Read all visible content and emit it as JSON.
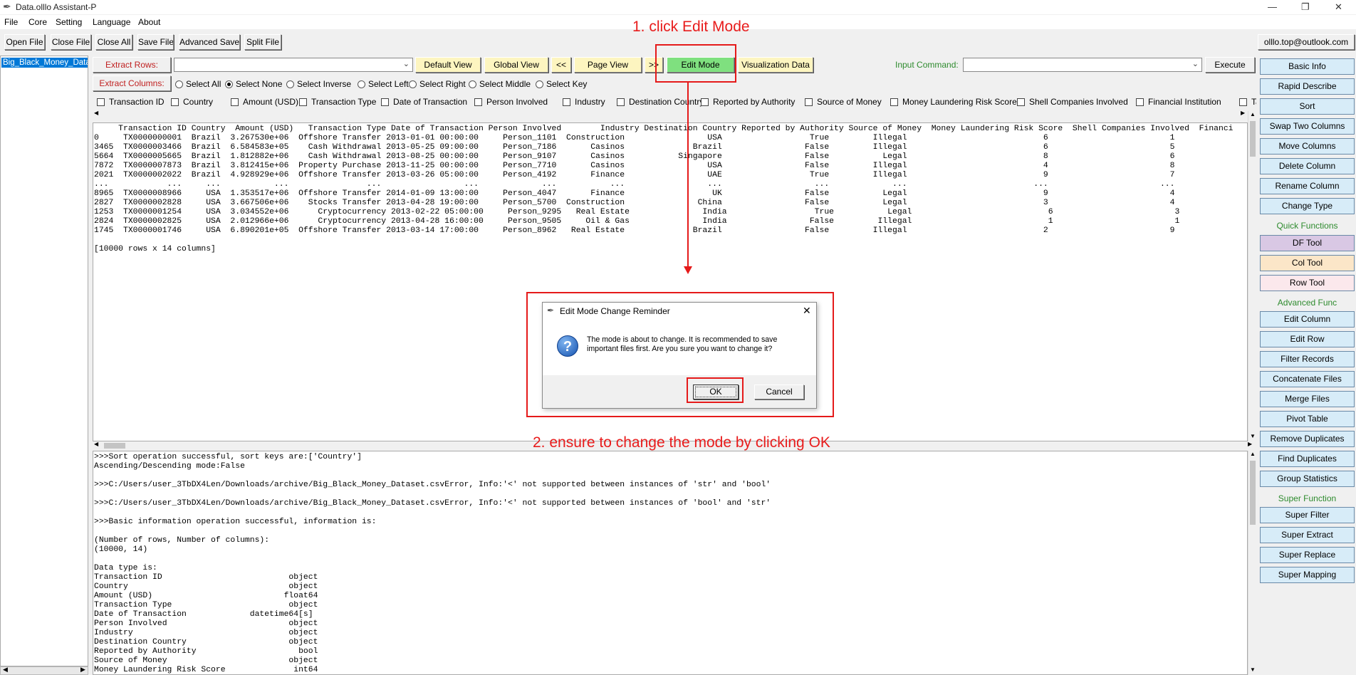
{
  "window": {
    "title": "Data.olllo Assistant-P",
    "minimize_glyph": "—",
    "restore_glyph": "❐",
    "close_glyph": "✕"
  },
  "menu": [
    "File",
    "Core",
    "Setting",
    "Language",
    "About"
  ],
  "toolbar": {
    "open_file": "Open File",
    "close_file": "Close File",
    "close_all": "Close All",
    "save_file": "Save File",
    "advanced_save": "Advanced Save",
    "split_file": "Split File"
  },
  "account": "olllo.top@outlook.com",
  "file_list": {
    "selected": "Big_Black_Money_Data"
  },
  "view_bar": {
    "extract_rows": "Extract Rows:",
    "extract_rows_value": "",
    "default_view": "Default View",
    "global_view": "Global View",
    "prev": "<<",
    "page_view": "Page View",
    "next": ">>",
    "edit_mode": "Edit Mode",
    "visualization": "Visualization Data",
    "input_command_label": "Input Command:",
    "input_command_value": "",
    "execute": "Execute"
  },
  "extract_columns": {
    "label": "Extract Columns:",
    "options": [
      "Select All",
      "Select None",
      "Select Inverse",
      "Select Left",
      "Select Right",
      "Select Middle",
      "Select Key"
    ],
    "selected": "Select None"
  },
  "columns_checklist": [
    "Transaction ID",
    "Country",
    "Amount (USD)",
    "Transaction Type",
    "Date of Transaction",
    "Person Involved",
    "Industry",
    "Destination Country",
    "Reported by Authority",
    "Source of Money",
    "Money Laundering Risk Score",
    "Shell Companies Involved",
    "Financial Institution",
    "Tax H"
  ],
  "table_output": [
    "     Transaction ID Country  Amount (USD)   Transaction Type Date of Transaction Person Involved        Industry Destination Country Reported by Authority Source of Money  Money Laundering Risk Score  Shell Companies Involved  Financi",
    "0     TX0000000001  Brazil  3.267530e+06  Offshore Transfer 2013-01-01 00:00:00     Person_1101  Construction                 USA                  True         Illegal                            6                         1",
    "3465  TX0000003466  Brazil  6.584583e+05    Cash Withdrawal 2013-05-25 09:00:00     Person_7186       Casinos              Brazil                 False         Illegal                            6                         5",
    "5664  TX0000005665  Brazil  1.812882e+06    Cash Withdrawal 2013-08-25 00:00:00     Person_9107       Casinos           Singapore                 False           Legal                            8                         6",
    "7872  TX0000007873  Brazil  3.812415e+06  Property Purchase 2013-11-25 00:00:00     Person_7710       Casinos                 USA                 False         Illegal                            4                         8",
    "2021  TX0000002022  Brazil  4.928929e+06  Offshore Transfer 2013-03-26 05:00:00     Person_4192       Finance                 UAE                  True         Illegal                            9                         7",
    "...            ...     ...           ...                ...                 ...             ...           ...                 ...                   ...             ...                          ...                       ...",
    "8965  TX0000008966     USA  1.353517e+06  Offshore Transfer 2014-01-09 13:00:00     Person_4047       Finance                  UK                 False           Legal                            9                         4",
    "2827  TX0000002828     USA  3.667506e+06    Stocks Transfer 2013-04-28 19:00:00     Person_5700  Construction               China                 False           Legal                            3                         4",
    "1253  TX0000001254     USA  3.034552e+06      Cryptocurrency 2013-02-22 05:00:00     Person_9295   Real Estate               India                  True           Legal                            6                         3",
    "2824  TX0000002825     USA  2.012966e+06      Cryptocurrency 2013-04-28 16:00:00     Person_9505     Oil & Gas               India                 False         Illegal                            1                         1",
    "1745  TX0000001746     USA  6.890201e+05  Offshore Transfer 2013-03-14 17:00:00     Person_8962   Real Estate              Brazil                 False         Illegal                            2                         9",
    "",
    "[10000 rows x 14 columns]"
  ],
  "log_output": [
    ">>>Sort operation successful, sort keys are:['Country']",
    "Ascending/Descending mode:False",
    "",
    ">>>C:/Users/user_3TbDX4Len/Downloads/archive/Big_Black_Money_Dataset.csvError, Info:'<' not supported between instances of 'str' and 'bool'",
    "",
    ">>>C:/Users/user_3TbDX4Len/Downloads/archive/Big_Black_Money_Dataset.csvError, Info:'<' not supported between instances of 'bool' and 'str'",
    "",
    ">>>Basic information operation successful, information is:",
    "",
    "(Number of rows, Number of columns):",
    "(10000, 14)",
    "",
    "Data type is:",
    "Transaction ID                          object",
    "Country                                 object",
    "Amount (USD)                           float64",
    "Transaction Type                        object",
    "Date of Transaction             datetime64[s]",
    "Person Involved                         object",
    "Industry                                object",
    "Destination Country                     object",
    "Reported by Authority                     bool",
    "Source of Money                         object",
    "Money Laundering Risk Score              int64"
  ],
  "side_panel": {
    "items": [
      {
        "type": "button",
        "label": "Basic Info"
      },
      {
        "type": "button",
        "label": "Rapid Describe"
      },
      {
        "type": "button",
        "label": "Sort"
      },
      {
        "type": "button",
        "label": "Swap Two Columns"
      },
      {
        "type": "button",
        "label": "Move Columns"
      },
      {
        "type": "button",
        "label": "Delete Column"
      },
      {
        "type": "button",
        "label": "Rename Column"
      },
      {
        "type": "button",
        "label": "Change Type"
      },
      {
        "type": "label",
        "label": "Quick Functions"
      },
      {
        "type": "button",
        "label": "DF Tool",
        "color": "#d9c8e4"
      },
      {
        "type": "button",
        "label": "Col Tool",
        "color": "#fbe6c8"
      },
      {
        "type": "button",
        "label": "Row Tool",
        "color": "#fbe8ec"
      },
      {
        "type": "label",
        "label": "Advanced Func"
      },
      {
        "type": "button",
        "label": "Edit Column"
      },
      {
        "type": "button",
        "label": "Edit Row"
      },
      {
        "type": "button",
        "label": "Filter Records"
      },
      {
        "type": "button",
        "label": "Concatenate Files"
      },
      {
        "type": "button",
        "label": "Merge Files"
      },
      {
        "type": "button",
        "label": "Pivot Table"
      },
      {
        "type": "button",
        "label": "Remove Duplicates"
      },
      {
        "type": "button",
        "label": "Find Duplicates"
      },
      {
        "type": "button",
        "label": "Group Statistics"
      },
      {
        "type": "label",
        "label": "Super Function"
      },
      {
        "type": "button",
        "label": "Super Filter"
      },
      {
        "type": "button",
        "label": "Super Extract"
      },
      {
        "type": "button",
        "label": "Super Replace"
      },
      {
        "type": "button",
        "label": "Super Mapping"
      }
    ]
  },
  "dialog": {
    "title": "Edit Mode Change Reminder",
    "message_line1": "The mode is about to change. It is recommended to save",
    "message_line2": "important files first. Are you sure you want to change it?",
    "ok": "OK",
    "cancel": "Cancel",
    "close_glyph": "✕",
    "question_glyph": "?"
  },
  "annotations": {
    "step1": "1. click Edit Mode",
    "step2": "2. ensure to change the mode by clicking OK"
  },
  "colors": {
    "edit_mode_bg": "#7fe07f",
    "view_btn_bg": "#fdf5c0",
    "side_btn_bg": "#d7ecf8",
    "annotation_red": "#e81c1c",
    "section_green": "#2e8b2e",
    "selected_file_bg": "#0078d7"
  }
}
